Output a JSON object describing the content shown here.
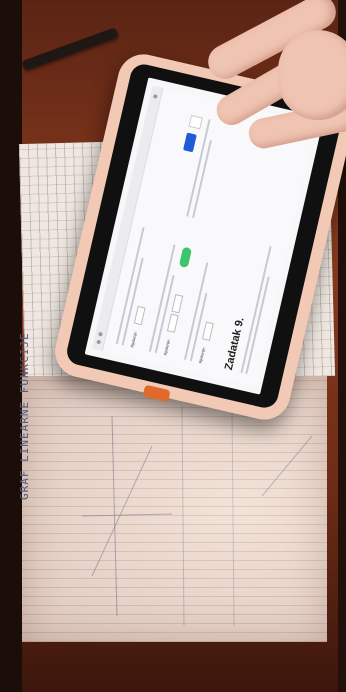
{
  "tablet_screen": {
    "title": "Zadatak 9.",
    "accent_button_color": "#1e5bd6",
    "status_pill_color": "#3cc56a",
    "answer_label": "Rješenje:"
  },
  "notebook": {
    "handwriting": "GRAF LINEARNE FUNKCIJE"
  }
}
